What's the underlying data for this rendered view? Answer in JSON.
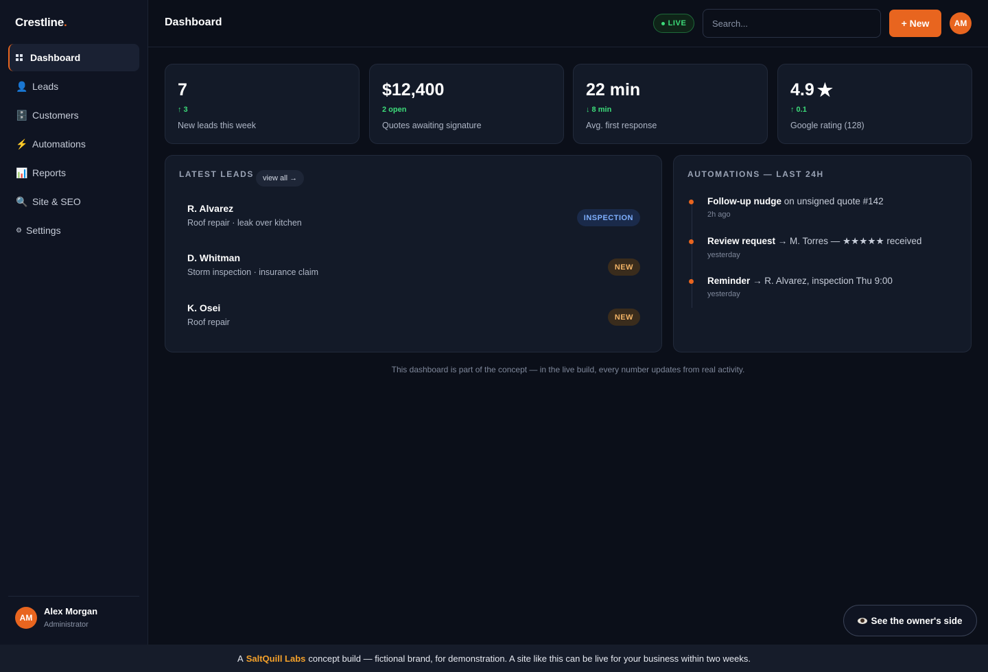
{
  "brand": {
    "name": "Crestline",
    "dot": "."
  },
  "sidebar": {
    "items": [
      {
        "label": "Dashboard",
        "icon": "grid-icon"
      },
      {
        "label": "Leads",
        "icon": "user-icon",
        "glyph": "👤"
      },
      {
        "label": "Customers",
        "icon": "cabinet-icon",
        "glyph": "🗄️"
      },
      {
        "label": "Automations",
        "icon": "lightning-icon",
        "glyph": "⚡"
      },
      {
        "label": "Reports",
        "icon": "bar-chart-icon",
        "glyph": "📊"
      },
      {
        "label": "Site & SEO",
        "icon": "magnifier-icon",
        "glyph": "🔍"
      },
      {
        "label": "Settings",
        "icon": "gear-icon",
        "glyph": "⚙"
      }
    ],
    "active_index": 0,
    "user": {
      "initials": "AM",
      "name": "Alex Morgan",
      "role": "Administrator"
    }
  },
  "header": {
    "title": "Dashboard",
    "live_label": "LIVE",
    "search_placeholder": "Search...",
    "new_button": "+ New",
    "avatar_initials": "AM"
  },
  "stats": [
    {
      "value": "7",
      "delta": "↑ 3",
      "label": "New leads this week"
    },
    {
      "value": "$12,400",
      "delta": "2 open",
      "label": "Quotes awaiting signature"
    },
    {
      "value": "22 min",
      "delta": "↓ 8 min",
      "label": "Avg. first response"
    },
    {
      "value": "4.9",
      "value_icon": "★",
      "delta": "↑ 0.1",
      "label": "Google rating (128)"
    }
  ],
  "latest_leads": {
    "title": "LATEST LEADS",
    "view_all": "view all →",
    "items": [
      {
        "name": "R. Alvarez",
        "desc": "Roof repair · leak over kitchen",
        "status": "INSPECTION"
      },
      {
        "name": "D. Whitman",
        "desc": "Storm inspection · insurance claim",
        "status": "NEW"
      },
      {
        "name": "K. Osei",
        "desc": "Roof repair",
        "status": "NEW"
      }
    ]
  },
  "automations": {
    "title": "AUTOMATIONS — LAST 24H",
    "items": [
      {
        "action": "Follow-up nudge",
        "detail": " on unsigned quote #142",
        "time": "2h ago"
      },
      {
        "action": "Review request",
        "detail": " → M. Torres — ★★★★★ received",
        "time": "yesterday"
      },
      {
        "action": "Reminder",
        "detail": " → R. Alvarez, inspection Thu 9:00",
        "time": "yesterday"
      }
    ]
  },
  "footnote": "This dashboard is part of the concept — in the live build, every number updates from real activity.",
  "owner_button": "See the owner's side",
  "bottom_bar": {
    "prefix": "A",
    "brand": "SaltQuill Labs",
    "suffix": "concept build — fictional brand, for demonstration. A site like this can be live for your business within two weeks."
  },
  "colors": {
    "accent": "#e8651f",
    "positive": "#3ddc7a",
    "background": "#0b0f19",
    "panel": "#131a28"
  }
}
